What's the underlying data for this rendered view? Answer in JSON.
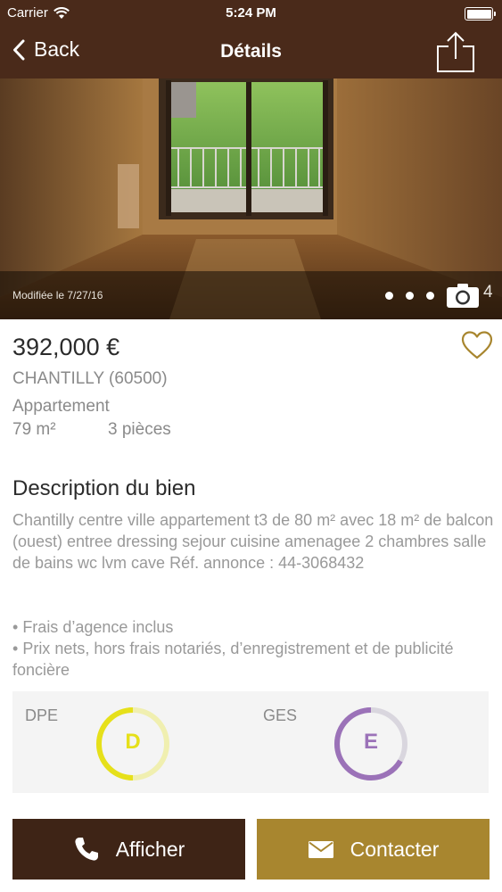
{
  "status_bar": {
    "carrier": "Carrier",
    "time": "5:24 PM"
  },
  "nav": {
    "back_label": "Back",
    "title": "Détails"
  },
  "photo": {
    "modified_text": "Modifiée le 7/27/16",
    "photo_count": "4"
  },
  "listing": {
    "price": "392,000 €",
    "city": "CHANTILLY (60500)",
    "property_type": "Appartement",
    "area": "79 m²",
    "rooms": "3 pièces"
  },
  "description": {
    "title": "Description du bien",
    "text": "Chantilly centre ville appartement t3 de 80 m² avec 18 m² de balcon (ouest) entree dressing sejour cuisine amenagee 2 chambres salle de bains wc lvm cave Réf. annonce : 44-3068432",
    "bullets": [
      "Frais d’agence inclus",
      "Prix nets, hors frais notariés, d’enregistrement et de publicité foncière"
    ]
  },
  "energy": {
    "dpe_label": "DPE",
    "dpe_grade": "D",
    "dpe_color": "#e6e01a",
    "ges_label": "GES",
    "ges_grade": "E",
    "ges_color": "#9b72b8"
  },
  "actions": {
    "call_label": "Afficher",
    "contact_label": "Contacter"
  },
  "colors": {
    "header_bg": "#4a2a1a",
    "call_bg": "#3e2416",
    "contact_bg": "#a8862f",
    "heart": "#a8862f"
  },
  "icons": {
    "wifi": "wifi-icon",
    "battery": "battery-icon",
    "back": "chevron-left-icon",
    "share": "share-icon",
    "camera": "camera-icon",
    "favorite": "heart-icon",
    "call": "phone-icon",
    "contact": "envelope-icon"
  }
}
